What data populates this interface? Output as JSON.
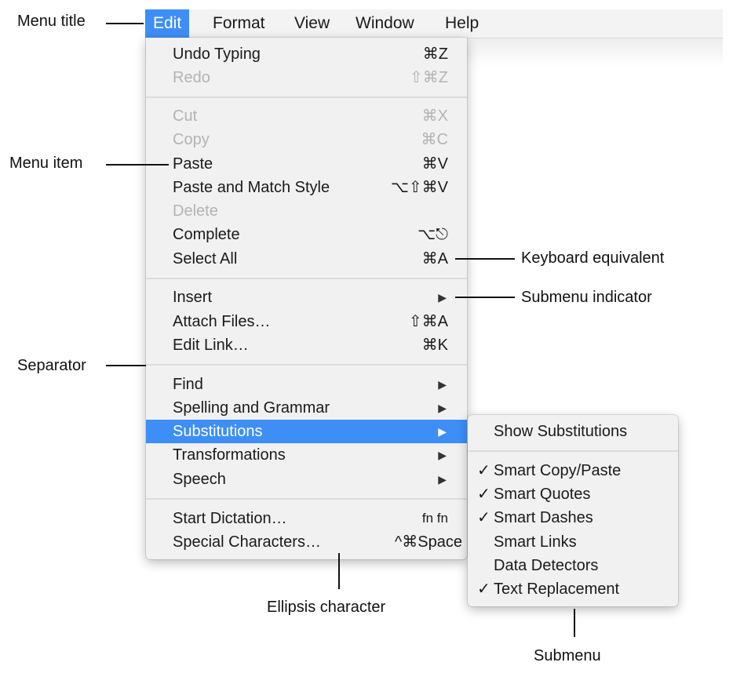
{
  "menubar": {
    "items": [
      {
        "label": "Edit",
        "active": true
      },
      {
        "label": "Format"
      },
      {
        "label": "View"
      },
      {
        "label": "Window"
      },
      {
        "label": "Help"
      }
    ]
  },
  "edit_menu": {
    "items": [
      {
        "label": "Undo Typing",
        "shortcut": "⌘Z"
      },
      {
        "label": "Redo",
        "shortcut": "⇧⌘Z",
        "disabled": true
      },
      {
        "label": "Cut",
        "shortcut": "⌘X",
        "disabled": true
      },
      {
        "label": "Copy",
        "shortcut": "⌘C",
        "disabled": true
      },
      {
        "label": "Paste",
        "shortcut": "⌘V"
      },
      {
        "label": "Paste and Match Style",
        "shortcut": "⌥⇧⌘V"
      },
      {
        "label": "Delete",
        "disabled": true
      },
      {
        "label": "Complete",
        "shortcut": "⌥⎋"
      },
      {
        "label": "Select All",
        "shortcut": "⌘A"
      },
      {
        "label": "Insert",
        "submenu": true
      },
      {
        "label": "Attach Files…",
        "shortcut": "⇧⌘A"
      },
      {
        "label": "Edit Link…",
        "shortcut": "⌘K"
      },
      {
        "label": "Find",
        "submenu": true
      },
      {
        "label": "Spelling and Grammar",
        "submenu": true
      },
      {
        "label": "Substitutions",
        "submenu": true,
        "highlighted": true
      },
      {
        "label": "Transformations",
        "submenu": true
      },
      {
        "label": "Speech",
        "submenu": true
      },
      {
        "label": "Start Dictation…",
        "shortcut": "fn fn"
      },
      {
        "label": "Special Characters…",
        "shortcut": "^⌘Space"
      }
    ],
    "submenu_arrow": "▶"
  },
  "substitutions_submenu": {
    "items": [
      {
        "label": "Show Substitutions",
        "checked": false
      },
      {
        "label": "Smart Copy/Paste",
        "checked": true
      },
      {
        "label": "Smart Quotes",
        "checked": true
      },
      {
        "label": "Smart Dashes",
        "checked": true
      },
      {
        "label": "Smart Links",
        "checked": false
      },
      {
        "label": "Data Detectors",
        "checked": false
      },
      {
        "label": "Text Replacement",
        "checked": true
      }
    ],
    "check_glyph": "✓"
  },
  "callouts": {
    "menu_title": "Menu title",
    "menu_item": "Menu item",
    "separator": "Separator",
    "keyboard_equivalent": "Keyboard equivalent",
    "submenu_indicator": "Submenu indicator",
    "ellipsis_character": "Ellipsis character",
    "submenu": "Submenu"
  },
  "colors": {
    "highlight": "#3e8ef7",
    "menu_bg": "#f1f1f1",
    "disabled_text": "#b3b3b3"
  }
}
